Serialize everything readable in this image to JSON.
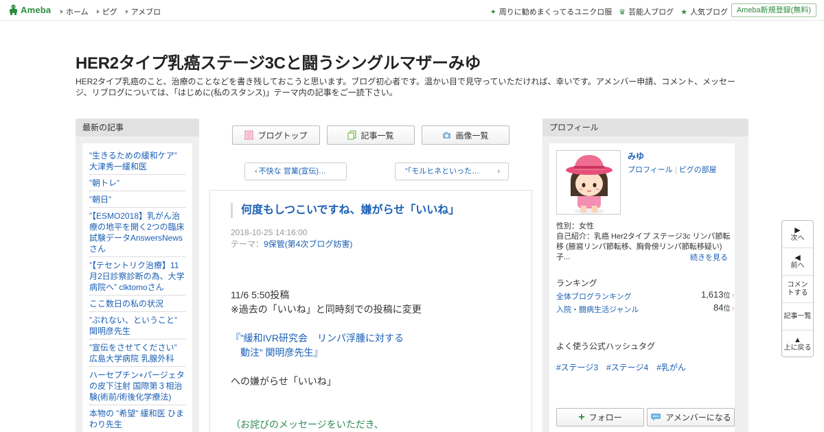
{
  "topbar": {
    "logo_text": "Ameba",
    "nav": [
      "ホーム",
      "ピグ",
      "アメブロ"
    ],
    "right_links": [
      {
        "icon": "sparkle-icon",
        "label": "周りに勧めまくってるユニクロ服"
      },
      {
        "icon": "crown-icon",
        "label": "芸能人ブログ"
      },
      {
        "icon": "star-icon",
        "label": "人気ブログ"
      }
    ],
    "register_label": "Ameba新規登録(無料)"
  },
  "header": {
    "title": "HER2タイプ乳癌ステージ3Cと闘うシングルマザーみゆ",
    "description": "HER2タイプ乳癌のこと、治療のことなどを書き残しておこうと思います。ブログ初心者です。温かい目で見守っていただければ、幸いです。アメンバー申請、コメント、メッセージ、リブログについては、「はじめに(私のスタンス)」テーマ内の記事をご一読下さい。"
  },
  "left_sidebar": {
    "heading": "最新の記事",
    "articles": [
      "”生きるための緩和ケア” 大津秀一緩和医",
      "”朝トレ”",
      "”朝日”",
      "”【ESMO2018】乳がん治療の地平を開く2つの臨床試験データAnswersNewsさん",
      "”【テセントリク治療】11月2日診察診断の為、大学病院へ” clktomoさん",
      "ここ数日の私の状況",
      "”ぶれない、ということ” 関明彦先生",
      "”宣伝をさせてください” 広島大学病院 乳腺外科",
      "ハーセプチン+パージェタの皮下注射 国際第３相治験(術前/術後化学療法)",
      "本物の ”希望” 緩和医 ひまわり先生"
    ]
  },
  "center": {
    "buttons": [
      "ブログトップ",
      "記事一覧",
      "画像一覧"
    ],
    "prev_label": "不快な 営業(宣伝)…",
    "next_label": "”「モルヒネといった…",
    "entry": {
      "title": "何度もしつこいですね、嫌がらせ「いいね」",
      "date": "2018-10-25 14:16:00",
      "theme_label": "テーマ：",
      "theme": "9保管(第4次ブログ妨害)",
      "lines": [
        "11/6  5:50投稿",
        "※過去の「いいね」と同時刻での投稿に変更",
        "『”緩和IVR研究会　リンパ浮腫に対する",
        "　動注”  関明彦先生』",
        "への嫌がらせ「いいね」",
        "（お詫びのメッセージをいただき、"
      ]
    }
  },
  "right_sidebar": {
    "heading": "プロフィール",
    "name": "みゆ",
    "profile_link": "プロフィール",
    "pigg_link": "ピグの部屋",
    "gender": "性別：女性",
    "intro": "自己紹介：乳癌 Her2タイプ ステージ3c リンパ節転移 (腋窩リンパ節転移、胸骨傍リンパ節転移疑い) 子...",
    "read_more": "続きを見る",
    "ranking_label": "ランキング",
    "rankings": [
      {
        "label": "全体ブログランキング",
        "rank": "1,613",
        "unit": "位",
        "trend": "↑"
      },
      {
        "label": "入院・闘病生活ジャンル",
        "rank": "84",
        "unit": "位",
        "trend": "↑"
      }
    ],
    "hashtag_label": "よく使う公式ハッシュタグ",
    "hashtags": [
      "#ステージ3",
      "#ステージ4",
      "#乳がん"
    ],
    "follow_label": "フォロー",
    "amember_label": "アメンバーになる"
  },
  "float_nav": [
    "次へ",
    "前へ",
    "コメントする",
    "記事一覧",
    "上に戻る"
  ],
  "colors": {
    "brand": "#2d8c3c",
    "link": "#1a5fb4",
    "sidebar_bg": "#efefef",
    "accent_red": "#e0453a",
    "theme_green": "#2e8b57"
  }
}
